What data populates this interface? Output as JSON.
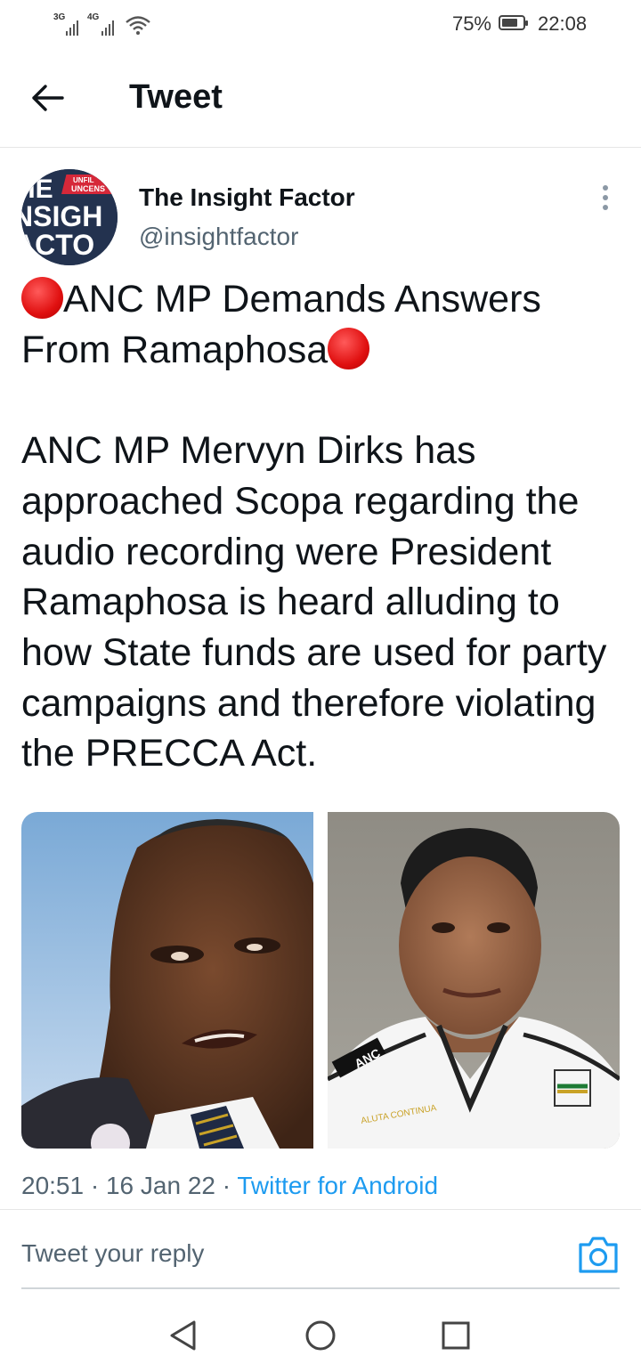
{
  "status_bar": {
    "signal_1_label": "3G",
    "signal_2_label": "4G",
    "wifi_icon": "wifi-icon",
    "battery_percent": "75%",
    "battery_level": 0.75,
    "time": "22:08"
  },
  "header": {
    "back_icon": "arrow-left-icon",
    "title": "Tweet"
  },
  "tweet": {
    "author": {
      "avatar_text": "THE INSIGHT FACTOR",
      "display_name": "The Insight Factor",
      "handle": "@insightfactor"
    },
    "more_icon": "more-vertical-icon",
    "headline": "ANC MP Demands Answers From Ramaphosa",
    "body": "ANC MP Mervyn Dirks has approached Scopa regarding the audio recording were President Ramaphosa is heard alluding to how State funds are used for party campaigns and therefore violating the PRECCA Act.",
    "emoji": "red-circle-emoji",
    "images": [
      {
        "name": "photo-ramaphosa"
      },
      {
        "name": "photo-mervyn-dirks",
        "shirt_text": "ANC"
      }
    ],
    "time": "20:51",
    "date": "16 Jan 22",
    "separator": "·",
    "source": "Twitter for Android"
  },
  "reply": {
    "placeholder": "Tweet your reply",
    "camera_icon": "camera-icon"
  },
  "nav": {
    "back": "triangle-back-icon",
    "home": "circle-home-icon",
    "recents": "square-recents-icon"
  },
  "colors": {
    "accent": "#1d9bf0",
    "text_primary": "#0f1419",
    "text_secondary": "#536471",
    "avatar_bg": "#23324f",
    "brand_red": "#d62839"
  }
}
